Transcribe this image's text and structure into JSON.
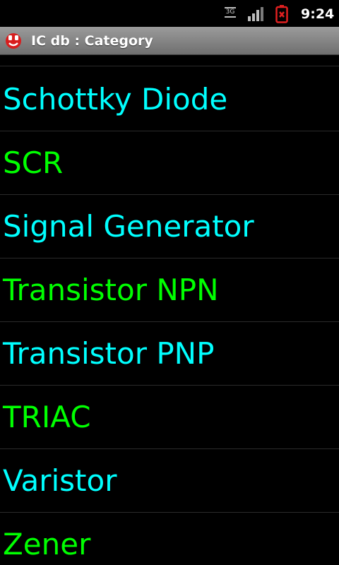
{
  "status_bar": {
    "network_label": "3G",
    "network_icon": "network-3g-icon",
    "signal_icon": "signal-strength-icon",
    "battery_icon": "battery-alert-icon",
    "time": "9:24"
  },
  "title_bar": {
    "app_icon": "app-icon",
    "title": "IC db : Category"
  },
  "categories": [
    {
      "label": "Schottky Diode",
      "color": "#00ffff"
    },
    {
      "label": "SCR",
      "color": "#00ff00"
    },
    {
      "label": "Signal Generator",
      "color": "#00ffff"
    },
    {
      "label": "Transistor NPN",
      "color": "#00ff00"
    },
    {
      "label": "Transistor PNP",
      "color": "#00ffff"
    },
    {
      "label": "TRIAC",
      "color": "#00ff00"
    },
    {
      "label": "Varistor",
      "color": "#00ffff"
    },
    {
      "label": "Zener",
      "color": "#00ff00"
    }
  ]
}
